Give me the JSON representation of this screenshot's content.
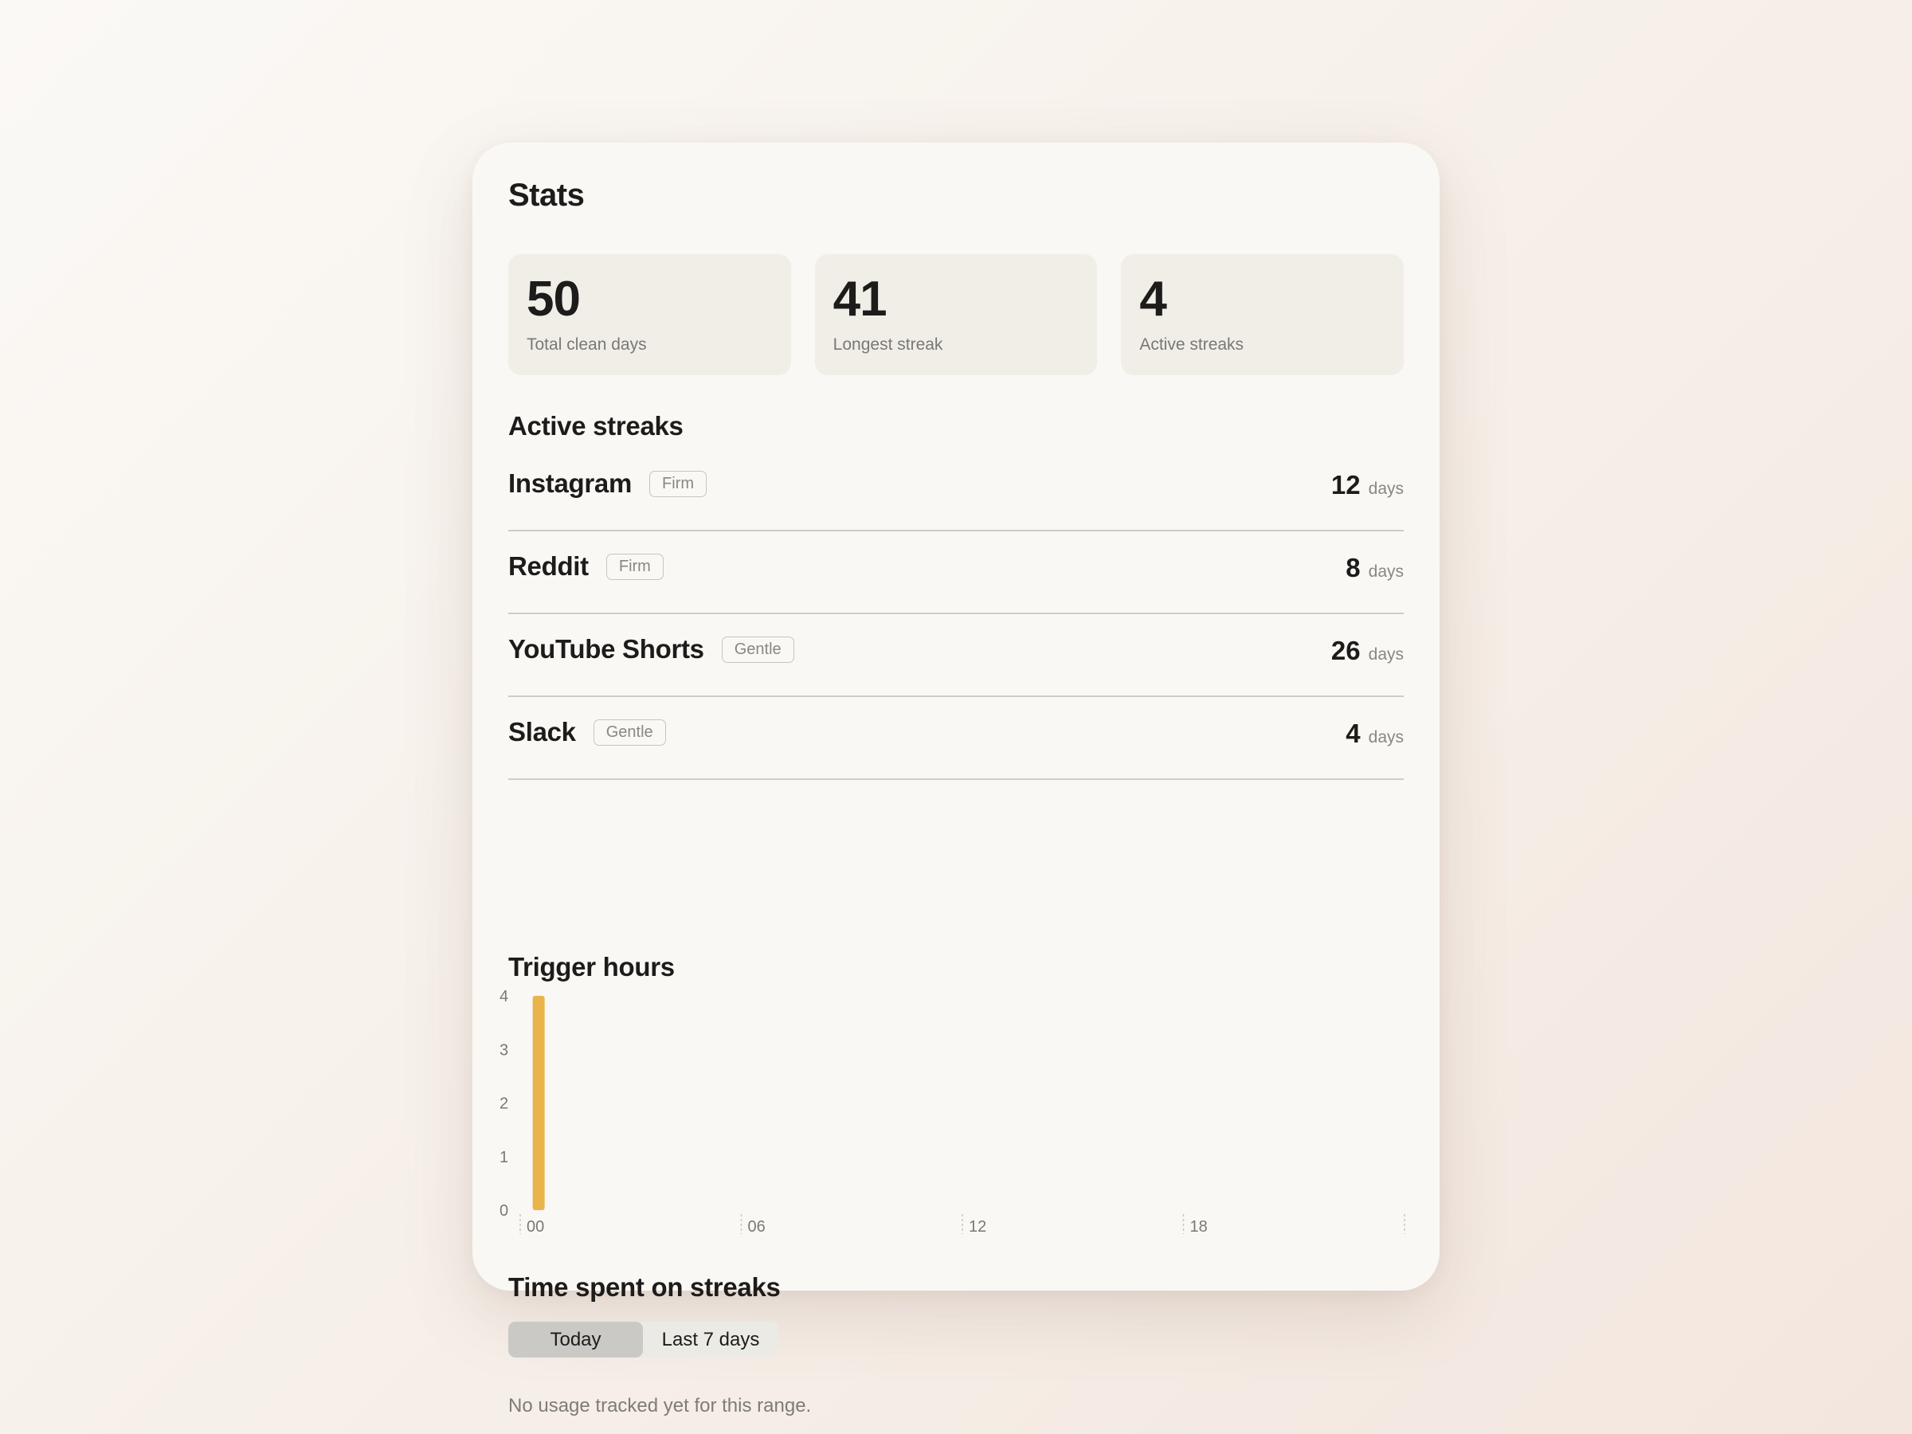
{
  "page": {
    "title": "Stats"
  },
  "summary": [
    {
      "value": "50",
      "label": "Total clean days"
    },
    {
      "value": "41",
      "label": "Longest streak"
    },
    {
      "value": "4",
      "label": "Active streaks"
    }
  ],
  "active_streaks": {
    "heading": "Active streaks",
    "unit": "days",
    "items": [
      {
        "name": "Instagram",
        "mode": "Firm",
        "days": "12"
      },
      {
        "name": "Reddit",
        "mode": "Firm",
        "days": "8"
      },
      {
        "name": "YouTube Shorts",
        "mode": "Gentle",
        "days": "26"
      },
      {
        "name": "Slack",
        "mode": "Gentle",
        "days": "4"
      }
    ]
  },
  "trigger_hours": {
    "heading": "Trigger hours"
  },
  "chart_data": {
    "type": "bar",
    "title": "Trigger hours",
    "xlabel": "",
    "ylabel": "",
    "x": [
      0,
      1,
      2,
      3,
      4,
      5,
      6,
      7,
      8,
      9,
      10,
      11,
      12,
      13,
      14,
      15,
      16,
      17,
      18,
      19,
      20,
      21,
      22,
      23
    ],
    "values": [
      4,
      0,
      0,
      0,
      0,
      0,
      0,
      0,
      0,
      0,
      0,
      0,
      0,
      0,
      0,
      0,
      0,
      0,
      0,
      0,
      0,
      0,
      0,
      0
    ],
    "xtick_labels": [
      "00",
      "06",
      "12",
      "18"
    ],
    "ytick_labels": [
      "0",
      "1",
      "2",
      "3",
      "4"
    ],
    "ylim": [
      0,
      4
    ],
    "grid": false,
    "bar_color": "#e9b54a"
  },
  "time_spent": {
    "heading": "Time spent on streaks",
    "tabs": [
      {
        "label": "Today",
        "selected": true
      },
      {
        "label": "Last 7 days",
        "selected": false
      }
    ],
    "empty_message": "No usage tracked yet for this range."
  }
}
